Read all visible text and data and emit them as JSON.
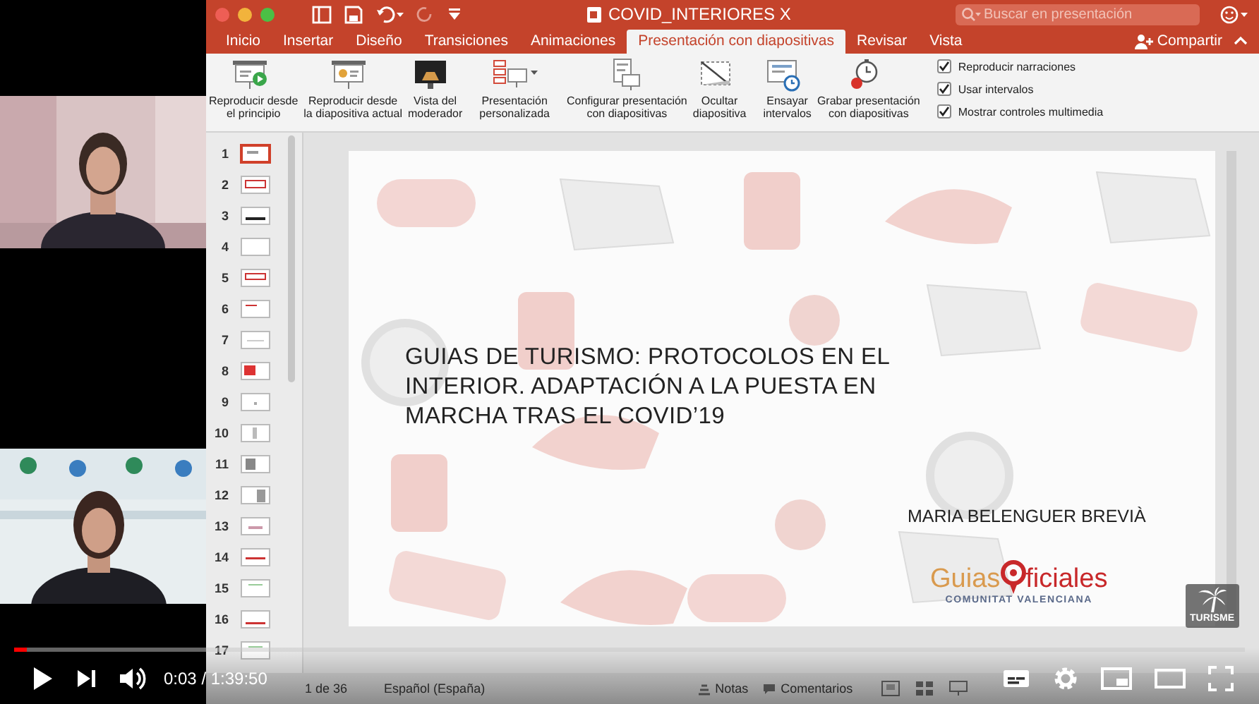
{
  "window": {
    "title": "COVID_INTERIORES X",
    "search": {
      "placeholder": "Buscar en presentación"
    }
  },
  "tabs": [
    {
      "label": "Inicio",
      "selected": false
    },
    {
      "label": "Insertar",
      "selected": false
    },
    {
      "label": "Diseño",
      "selected": false
    },
    {
      "label": "Transiciones",
      "selected": false
    },
    {
      "label": "Animaciones",
      "selected": false
    },
    {
      "label": "Presentación con diapositivas",
      "selected": true
    },
    {
      "label": "Revisar",
      "selected": false
    },
    {
      "label": "Vista",
      "selected": false
    }
  ],
  "share_button": "Compartir",
  "ribbon": {
    "buttons": [
      {
        "label": "Reproducir desde\nel principio",
        "kind": "start"
      },
      {
        "label": "Reproducir desde\nla diapositiva actual",
        "kind": "current"
      },
      {
        "label": "Vista del\nmoderador",
        "kind": "presenter"
      },
      {
        "label": "Presentación\npersonalizada",
        "kind": "custom"
      },
      {
        "label": "Configurar presentación\ncon diapositivas",
        "kind": "setup"
      },
      {
        "label": "Ocultar\ndiapositiva",
        "kind": "hide"
      },
      {
        "label": "Ensayar\nintervalos",
        "kind": "rehearse"
      },
      {
        "label": "Grabar presentación\ncon diapositivas",
        "kind": "record"
      }
    ],
    "options": [
      {
        "label": "Reproducir narraciones",
        "checked": true
      },
      {
        "label": "Usar intervalos",
        "checked": true
      },
      {
        "label": "Mostrar controles multimedia",
        "checked": true
      }
    ]
  },
  "thumbnails": [
    {
      "number": "1",
      "selected": true
    },
    {
      "number": "2",
      "selected": false
    },
    {
      "number": "3",
      "selected": false
    },
    {
      "number": "4",
      "selected": false
    },
    {
      "number": "5",
      "selected": false
    },
    {
      "number": "6",
      "selected": false
    },
    {
      "number": "7",
      "selected": false
    },
    {
      "number": "8",
      "selected": false
    },
    {
      "number": "9",
      "selected": false
    },
    {
      "number": "10",
      "selected": false
    },
    {
      "number": "11",
      "selected": false
    },
    {
      "number": "12",
      "selected": false
    },
    {
      "number": "13",
      "selected": false
    },
    {
      "number": "14",
      "selected": false
    },
    {
      "number": "15",
      "selected": false
    },
    {
      "number": "16",
      "selected": false
    },
    {
      "number": "17",
      "selected": false
    }
  ],
  "slide": {
    "title": "GUIAS DE TURISMO: PROTOCOLOS EN EL INTERIOR. ADAPTACIÓN A LA PUESTA EN MARCHA TRAS EL COVID’19",
    "author": "MARIA BELENGUER BREVIÀ",
    "logo": {
      "word_1": "Guias",
      "word_2": "ficiales",
      "region": "COMUNITAT VALENCIANA"
    }
  },
  "channel_badge": "TURISME",
  "status_bar": {
    "slide_count": "1 de 36",
    "language": "Español (España)",
    "notes": "Notas",
    "comments": "Comentarios"
  },
  "video_player": {
    "time": "0:03 / 1:39:50",
    "progress": {
      "level": 0.01
    }
  }
}
